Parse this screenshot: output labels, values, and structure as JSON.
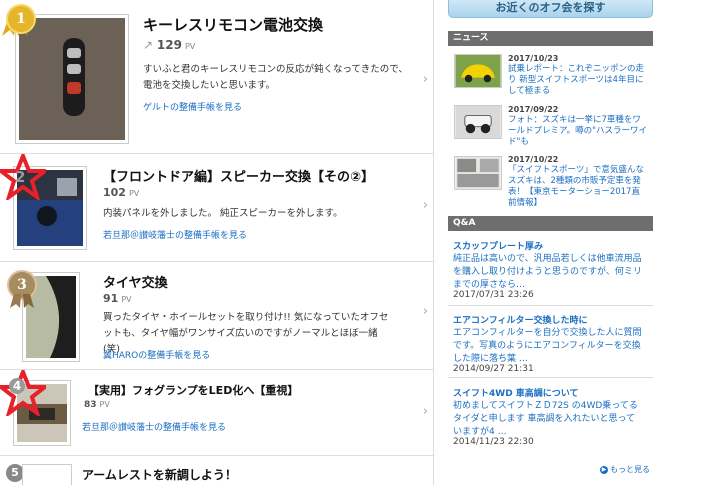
{
  "ranking": [
    {
      "rank": "1",
      "title": "キーレスリモコン電池交換",
      "pv": "129",
      "pv_unit": "PV",
      "desc": "すいふと君のキーレスリモコンの反応が鈍くなってきたので、電池を交換したいと思います。",
      "link": "ゲルトの整備手帳を見る"
    },
    {
      "rank": "2",
      "title": "【フロントドア編】スピーカー交換【その②】",
      "pv": "102",
      "pv_unit": "PV",
      "desc": "内装パネルを外しました。 純正スピーカーを外します。",
      "link": "若旦那＠讃岐藩士の整備手帳を見る"
    },
    {
      "rank": "3",
      "title": "タイヤ交換",
      "pv": "91",
      "pv_unit": "PV",
      "desc": "買ったタイヤ・ホイールセットを取り付け!! 気になっていたオフセットも、タイヤ幅がワンサイズ広いのですがノーマルとほぼ一緒(笑)",
      "link": "翼HAROの整備手帳を見る"
    },
    {
      "rank": "4",
      "title": "【実用】フォグランプをLED化へ【重視】",
      "pv": "83",
      "pv_unit": "PV",
      "link": "若旦那＠讃岐藩士の整備手帳を見る"
    },
    {
      "rank": "5",
      "title": "アームレストを新調しよう！"
    }
  ],
  "sidebar": {
    "cta_label": "お近くのオフ会を探す",
    "news_heading": "ニュース",
    "news": [
      {
        "date": "2017/10/23",
        "text": "試乗レポート：これぞニッポンの走り 新型スイフトスポーツは4年目にして極まる"
      },
      {
        "date": "2017/09/22",
        "text": "フォト：スズキは一挙に7車種をワールドプレミア。噂の\"ハスラーワイド\"も"
      },
      {
        "date": "2017/10/22",
        "text": "「スイフトスポーツ」で意気盛んなスズキは、2種類の市販予定車を発表！【東京モーターショー2017直前情報】"
      }
    ],
    "qa_heading": "Q&A",
    "qa": [
      {
        "title": "スカッフプレート厚み",
        "body": "純正品は高いので、汎用品若しくは他車流用品を購入し取り付けようと思うのですが、何ミリまでの厚さなら…",
        "date": "2017/07/31 23:26"
      },
      {
        "title": "エアコンフィルター交換した時に",
        "body": "エアコンフィルターを自分で交換した人に質問です。写真のようにエアコンフィルターを交換した際に落ち葉 …",
        "date": "2014/09/27 21:31"
      },
      {
        "title": "スイフト4WD 車高調について",
        "body": "初めましてスイフトＺＤ72S の4WD乗ってるタイダと申します 車高調を入れたいと思っていますが4 …",
        "date": "2014/11/23 22:30"
      }
    ],
    "more_label": "もっと見る"
  },
  "colors": {
    "link": "#1b6fc2",
    "gold": "#e6b52a",
    "bronze": "#a98b62",
    "star_red": "#e8202a",
    "header_gray": "#6e6e6e"
  }
}
